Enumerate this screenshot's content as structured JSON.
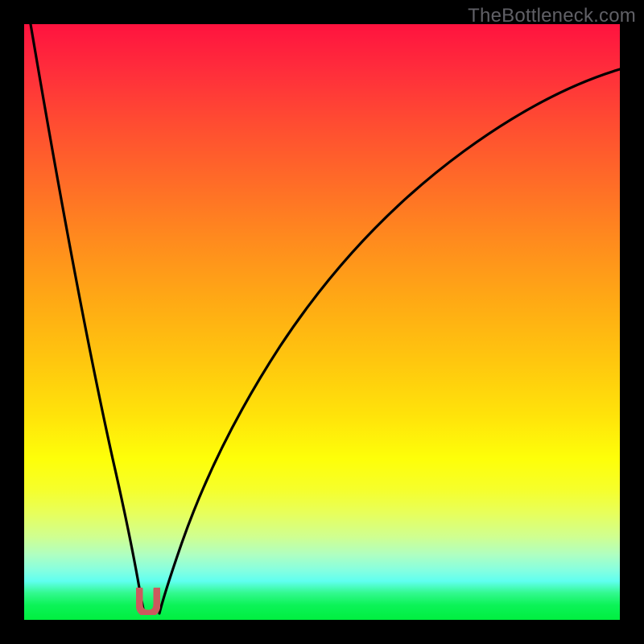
{
  "watermark": "TheBottleneck.com",
  "colors": {
    "background": "#000000",
    "curve": "#000000",
    "marker": "#cb5a5e",
    "gradient_top": "#ff133f",
    "gradient_mid": "#ffe40a",
    "gradient_bottom": "#00ef40"
  },
  "chart_data": {
    "type": "line",
    "title": "",
    "xlabel": "",
    "ylabel": "",
    "xlim": [
      0,
      100
    ],
    "ylim": [
      0,
      100
    ],
    "legend": false,
    "grid": false,
    "note": "V-shaped bottleneck curve over red→yellow→green severity gradient. Optimal (zero-bottleneck) region marked by U symbol near x≈21. Axes unlabeled in image; values are pixel-read estimates.",
    "series": [
      {
        "name": "left-branch",
        "x": [
          0,
          2,
          4,
          6,
          8,
          10,
          12,
          14,
          16,
          17,
          18,
          19,
          19.5,
          20
        ],
        "y": [
          100,
          92,
          83,
          74,
          65,
          56,
          47,
          37,
          26,
          20,
          14,
          8,
          4,
          2
        ]
      },
      {
        "name": "right-branch",
        "x": [
          22,
          23,
          24,
          26,
          28,
          30,
          33,
          36,
          40,
          45,
          50,
          56,
          63,
          70,
          78,
          86,
          94,
          100
        ],
        "y": [
          2,
          6,
          10,
          17,
          23,
          29,
          36,
          42,
          49,
          57,
          63,
          69,
          75,
          80,
          85,
          89,
          92,
          94
        ]
      }
    ],
    "marker": {
      "name": "optimal-point",
      "shape": "U",
      "x": 21,
      "y": 2,
      "color": "#cb5a5e"
    }
  }
}
